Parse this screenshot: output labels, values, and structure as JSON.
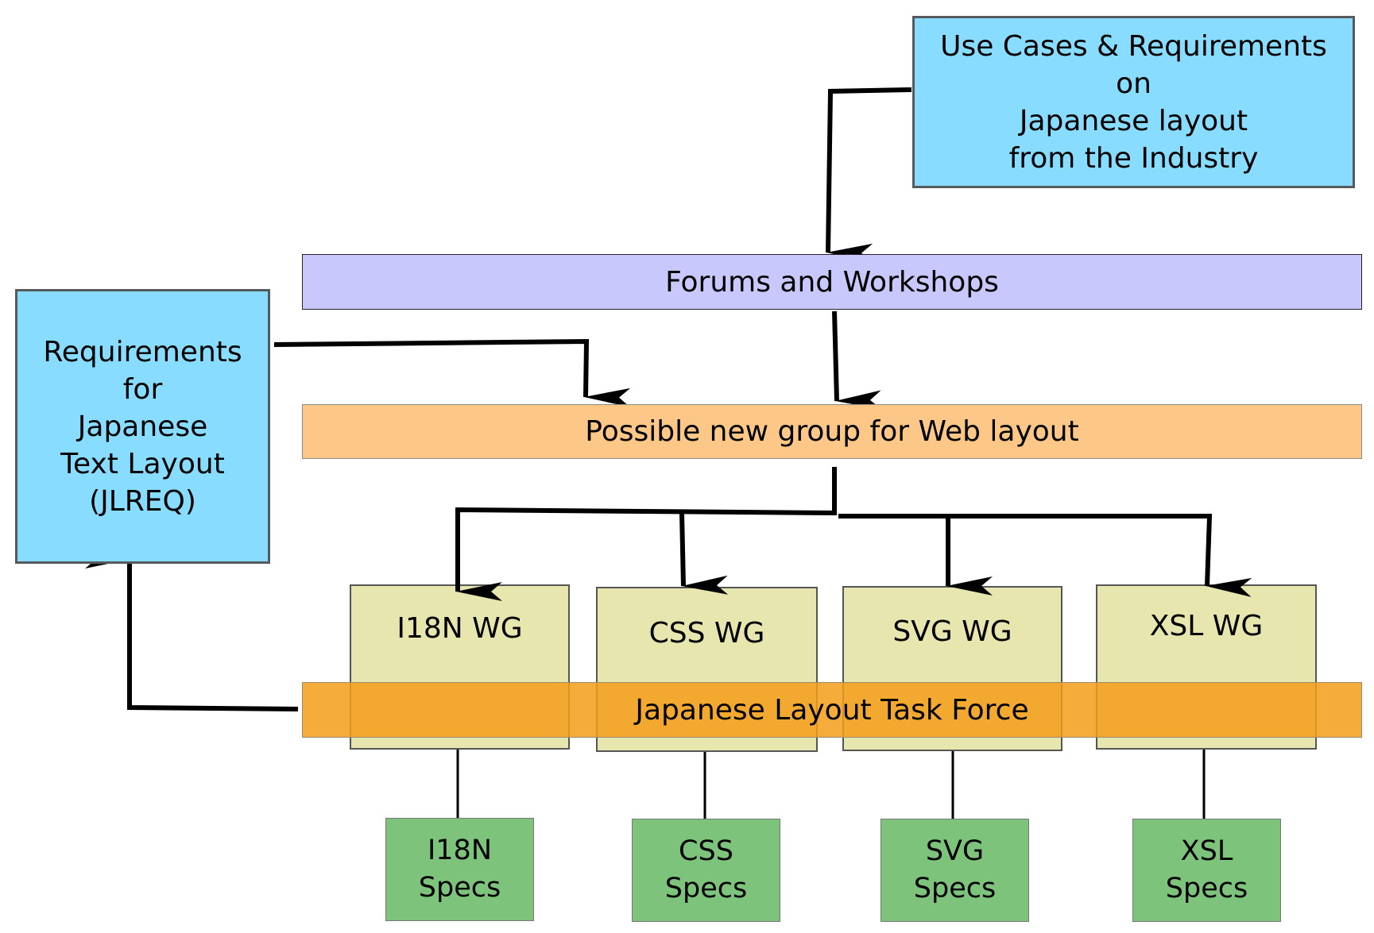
{
  "diagram": {
    "use_cases": "Use Cases & Requirements\non\nJapanese layout\nfrom the Industry",
    "forums": "Forums and Workshops",
    "jlreq": "Requirements\nfor\nJapanese\nText Layout\n(JLREQ)",
    "new_group": "Possible new group for Web layout",
    "task_force": "Japanese Layout Task Force",
    "working_groups": [
      {
        "label": "I18N WG",
        "spec": "I18N\nSpecs"
      },
      {
        "label": "CSS WG",
        "spec": "CSS\nSpecs"
      },
      {
        "label": "SVG WG",
        "spec": "SVG\nSpecs"
      },
      {
        "label": "XSL WG",
        "spec": "XSL\nSpecs"
      }
    ]
  },
  "colors": {
    "requirements_box": "#87dcff",
    "forums_box": "#c8c8fc",
    "new_group_box": "#fdc887",
    "wg_box": "#e6e6ae",
    "spec_box": "#7dc37b",
    "task_force_box": "#f59e19",
    "connector": "#000000"
  }
}
